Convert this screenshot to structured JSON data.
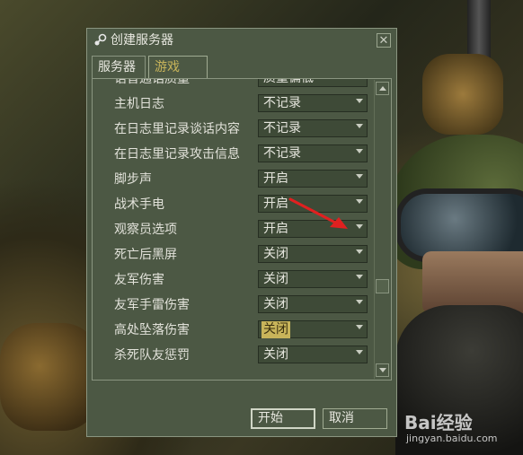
{
  "window": {
    "title": "创建服务器",
    "close_glyph": "✕"
  },
  "tabs": [
    {
      "label": "服务器",
      "active": false
    },
    {
      "label": "游戏",
      "active": true
    }
  ],
  "settings": [
    {
      "label": "语音通话质量",
      "value": "质量偏低"
    },
    {
      "label": "主机日志",
      "value": "不记录"
    },
    {
      "label": "在日志里记录谈话内容",
      "value": "不记录"
    },
    {
      "label": "在日志里记录攻击信息",
      "value": "不记录"
    },
    {
      "label": "脚步声",
      "value": "开启"
    },
    {
      "label": "战术手电",
      "value": "开启"
    },
    {
      "label": "观察员选项",
      "value": "开启"
    },
    {
      "label": "死亡后黑屏",
      "value": "关闭"
    },
    {
      "label": "友军伤害",
      "value": "关闭"
    },
    {
      "label": "友军手雷伤害",
      "value": "关闭"
    },
    {
      "label": "高处坠落伤害",
      "value": "关闭"
    },
    {
      "label": "杀死队友惩罚",
      "value": "关闭"
    }
  ],
  "buttons": {
    "start": "开始",
    "cancel": "取消"
  },
  "watermark": {
    "logo": "Bai经验",
    "url": "jingyan.baidu.com"
  },
  "colors": {
    "dialog_bg": "#4c5844",
    "active_tab_text": "#c8b45a",
    "highlight": "#c8b45a",
    "annotation_arrow": "#e02020"
  }
}
